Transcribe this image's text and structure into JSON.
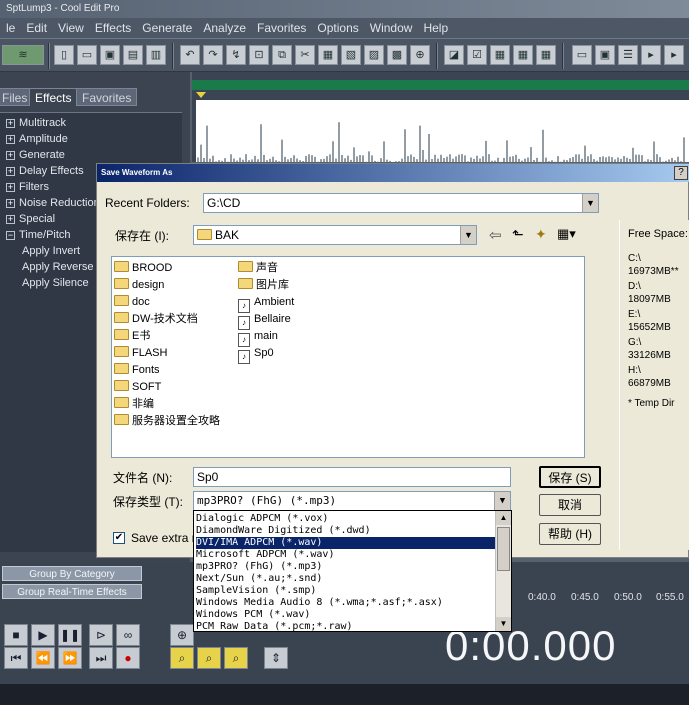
{
  "app": {
    "title": "SptLump3 - Cool Edit Pro"
  },
  "menu": [
    "le",
    "Edit",
    "View",
    "Effects",
    "Generate",
    "Analyze",
    "Favorites",
    "Options",
    "Window",
    "Help"
  ],
  "panel": {
    "tabs": [
      "Files",
      "Effects",
      "Favorites"
    ],
    "tree": [
      "Multitrack",
      "Amplitude",
      "Generate",
      "Delay Effects",
      "Filters",
      "Noise Reduction",
      "Special",
      "Time/Pitch"
    ],
    "subitems": [
      "Apply Invert",
      "Apply Reverse",
      "Apply Silence"
    ],
    "group_by_category": "Group By Category",
    "group_realtime": "Group Real-Time Effects"
  },
  "transport": {
    "time": "0:00.000",
    "ruler": [
      "0:40.0",
      "0:45.0",
      "0:50.0",
      "0:55.0"
    ]
  },
  "dialog": {
    "title": "Save Waveform As",
    "help_icon": "?",
    "recent_label": "Recent Folders:",
    "recent_value": "G:\\CD",
    "savein_label": "保存在 (I):",
    "savein_value": "BAK",
    "folders_col1": [
      "BROOD",
      "design",
      "doc",
      "DW-技术文档",
      "E书",
      "FLASH",
      "Fonts",
      "SOFT",
      "非编",
      "服务器设置全攻略"
    ],
    "col2_folders": [
      "声音",
      "图片库"
    ],
    "col2_files": [
      "Ambient",
      "Bellaire",
      "main",
      "Sp0"
    ],
    "filename_label": "文件名 (N):",
    "filename_value": "Sp0",
    "filetype_label": "保存类型 (T):",
    "filetype_value": "mp3PRO? (FhG) (*.mp3)",
    "save_button": "保存 (S)",
    "cancel_button": "取消",
    "help_button": "帮助 (H)",
    "save_extra": "Save extra no",
    "free_space": {
      "label": "Free Space:",
      "drives": [
        {
          "drive": "C:\\",
          "size": "16973MB**"
        },
        {
          "drive": "D:\\",
          "size": "18097MB"
        },
        {
          "drive": "E:\\",
          "size": "15652MB"
        },
        {
          "drive": "G:\\",
          "size": "33126MB"
        },
        {
          "drive": "H:\\",
          "size": "66879MB"
        }
      ],
      "note": "* Temp Dir"
    }
  },
  "dropdown": {
    "options": [
      "Dialogic ADPCM (*.vox)",
      "DiamondWare Digitized (*.dwd)",
      "DVI/IMA ADPCM (*.wav)",
      "Microsoft ADPCM (*.wav)",
      "mp3PRO? (FhG) (*.mp3)",
      "Next/Sun (*.au;*.snd)",
      "SampleVision (*.smp)",
      "Windows Media Audio 8 (*.wma;*.asf;*.asx)",
      "Windows PCM (*.wav)",
      "PCM Raw Data (*.pcm;*.raw)"
    ],
    "selected_index": 2
  }
}
